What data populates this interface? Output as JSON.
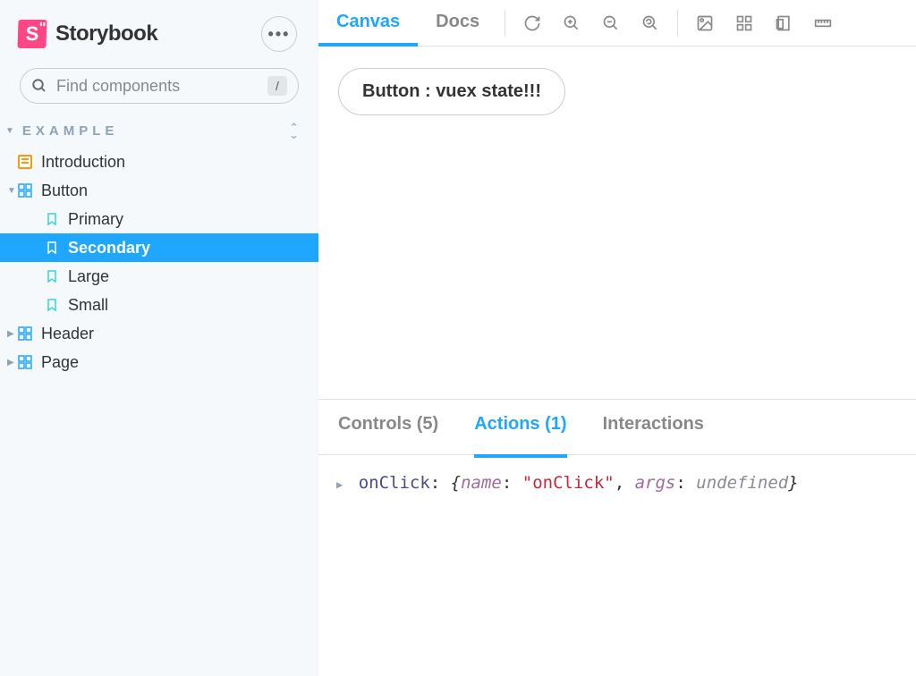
{
  "brand": "Storybook",
  "search": {
    "placeholder": "Find components",
    "shortcut": "/"
  },
  "section": {
    "label": "EXAMPLE"
  },
  "sidebar": {
    "items": [
      {
        "label": "Introduction",
        "kind": "doc"
      },
      {
        "label": "Button",
        "kind": "component",
        "expanded": true
      },
      {
        "label": "Primary",
        "kind": "story"
      },
      {
        "label": "Secondary",
        "kind": "story",
        "selected": true
      },
      {
        "label": "Large",
        "kind": "story"
      },
      {
        "label": "Small",
        "kind": "story"
      },
      {
        "label": "Header",
        "kind": "component"
      },
      {
        "label": "Page",
        "kind": "component"
      }
    ]
  },
  "tabs": {
    "canvas": "Canvas",
    "docs": "Docs"
  },
  "preview": {
    "button_label": "Button : vuex state!!!"
  },
  "addons": {
    "controls": "Controls (5)",
    "actions": "Actions (1)",
    "interactions": "Interactions"
  },
  "action_log": {
    "name": "onClick",
    "key1": "name",
    "val1": "\"onClick\"",
    "key2": "args",
    "val2": "undefined"
  }
}
